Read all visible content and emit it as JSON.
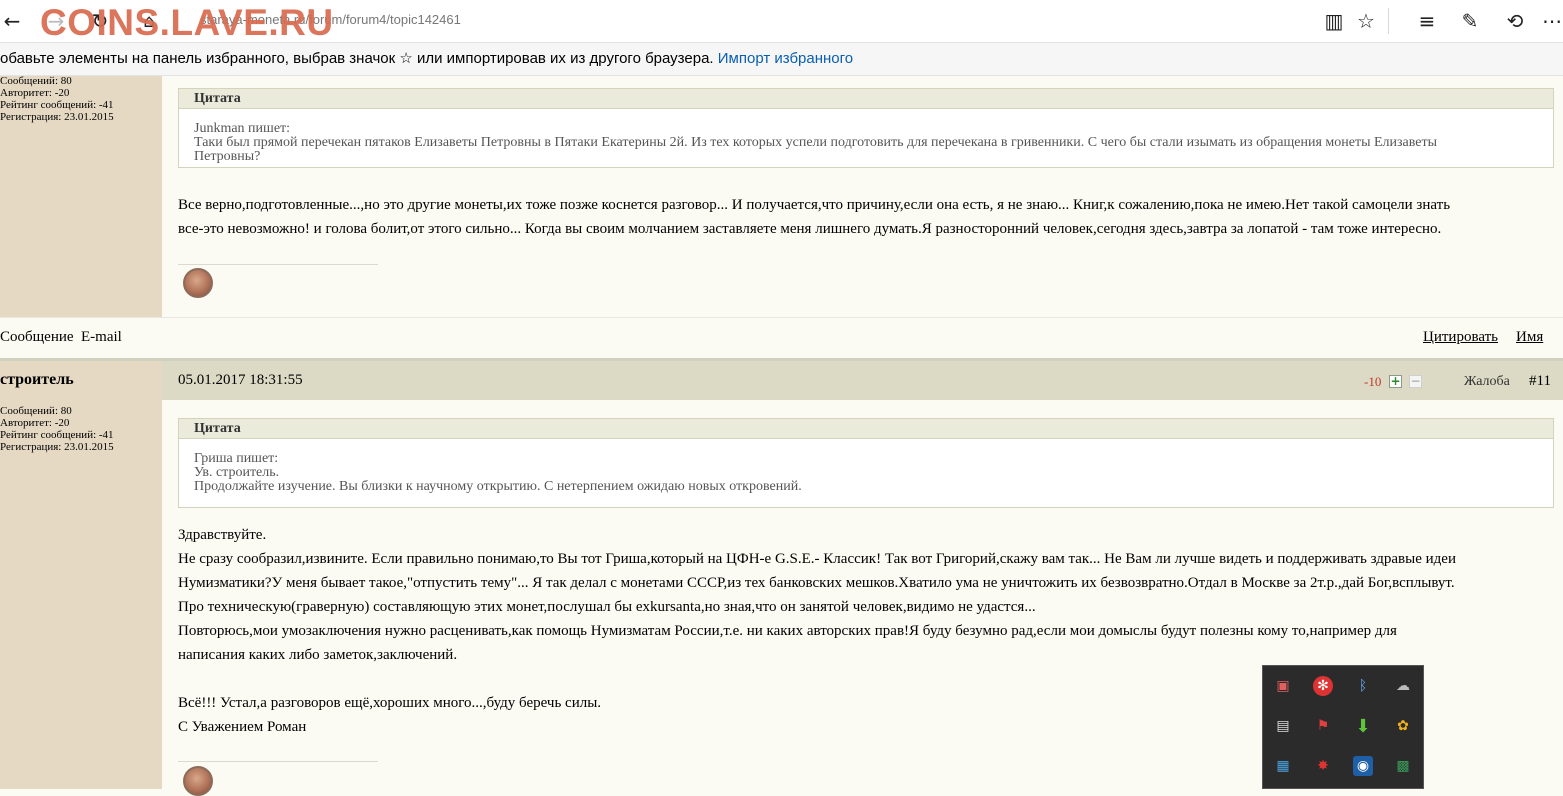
{
  "browser": {
    "url": "staraya-moneta.ru/forum/forum4/topic142461",
    "watermark": "COINS.LAVE.RU"
  },
  "favorites_bar": {
    "prompt": "обавьте элементы на панель избранного, выбрав значок ☆ или импортировав их из другого браузера.",
    "import_link": "Импорт избранного"
  },
  "post1": {
    "author_stats": {
      "messages": "Сообщений: 80",
      "authority": "Авторитет: -20",
      "rating": "Рейтинг сообщений: -41",
      "registered": "Регистрация: 23.01.2015"
    },
    "quote": {
      "title": "Цитата",
      "author_line": "Junkman пишет:",
      "lines": [
        "Таки был прямой перечекан пятаков Елизаветы Петровны в Пятаки Екатерины 2й. Из тех которых успели подготовить для перечекана в гривенники. С чего бы стали изымать из обращения монеты Елизаветы",
        "Петровны?"
      ]
    },
    "message_lines": [
      "Все верно,подготовленные...,но это другие монеты,их тоже позже коснется разговор... И получается,что причину,если она есть, я не знаю... Книг,к сожалению,пока не имею.Нет такой самоцели знать",
      "все-это невозможно! и голова болит,от этого сильно... Когда вы своим молчанием заставляете меня лишнего думать.Я разносторонний человек,сегодня здесь,завтра за лопатой - там тоже интересно."
    ],
    "footer": {
      "message_link": "Сообщение",
      "email_link": "E-mail",
      "quote_button": "Цитировать",
      "name_button": "Имя"
    }
  },
  "post2": {
    "author": "строитель",
    "date": "05.01.2017 18:31:55",
    "rating": "-10",
    "plus": "+",
    "minus": "−",
    "complaint": "Жалоба",
    "number": "#11",
    "author_stats": {
      "messages": "Сообщений: 80",
      "authority": "Авторитет: -20",
      "rating": "Рейтинг сообщений: -41",
      "registered": "Регистрация: 23.01.2015"
    },
    "quote": {
      "title": "Цитата",
      "author_line": "Гриша пишет:",
      "lines": [
        "Ув. строитель.",
        "Продолжайте изучение. Вы близки к научному открытию. С нетерпением ожидаю новых откровений."
      ]
    },
    "message_lines": [
      "Здравствуйте.",
      "Не сразу сообразил,извините. Если правильно понимаю,то Вы тот Гриша,который на ЦФН-е G.S.E.- Классик! Так вот Григорий,скажу вам так... Не Вам ли лучше видеть и поддерживать здравые идеи",
      "Нумизматики?У меня бывает такое,\"отпустить тему\"... Я так делал с монетами СССР,из тех банковских мешков.Хватило ума не уничтожить их безвозвратно.Отдал в Москве за 2т.р.,дай Бог,всплывут.",
      "Про техническую(граверную) составляющую этих монет,послушал бы exkursanta,но зная,что он занятой человек,видимо не удастся...",
      "Повторюсь,мои умозаключения нужно расценивать,как помощь Нумизматам России,т.е. ни каких авторских прав!Я буду безумно рад,если мои домыслы будут полезны кому то,например для",
      "написания каких либо заметок,заключений.",
      "",
      "Всё!!! Устал,а разговоров ещё,хороших много...,буду беречь силы.",
      "С Уважением Роман"
    ]
  },
  "colors": {
    "sidebar": "#e5d9c4",
    "post_header": "#dcdac4",
    "link": "#0a5fb0",
    "rating_negative": "#c0392b"
  },
  "tray_icons": [
    "display-icon",
    "asterisk-icon",
    "bluetooth-icon",
    "cloud-icon",
    "document-icon",
    "flag-icon",
    "download-arrow-icon",
    "flower-icon",
    "monitor-icon",
    "bug-icon",
    "camera-icon",
    "card-icon"
  ]
}
